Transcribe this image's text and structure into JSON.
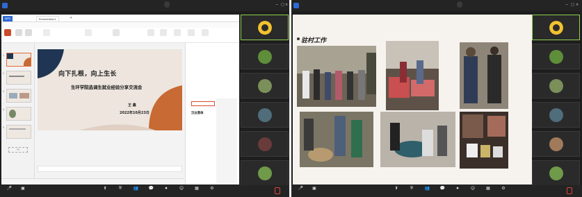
{
  "left": {
    "topbar": {
      "signal": "",
      "share_pill": "",
      "view_label": ""
    },
    "wps": {
      "tabs": [
        "WPS",
        "",
        "",
        "Presentation1"
      ],
      "menus": [
        "",
        "",
        "",
        "",
        "",
        "",
        "",
        "",
        "",
        "",
        "",
        ""
      ],
      "ribbon": [
        "",
        "",
        "",
        "",
        "",
        "",
        "",
        "",
        "",
        "",
        "",
        "",
        "",
        "",
        "",
        "",
        "",
        "",
        ""
      ]
    },
    "thumb_tabs": "",
    "thumb_numbers": [
      "1",
      "2",
      "3",
      "4",
      "5"
    ],
    "slide": {
      "title": "向下扎根，向上生长",
      "subtitle": "生环学院选调生就业经验分享交流会",
      "name": "王 鑫",
      "date": "2022年10月23日"
    },
    "notes_placeholder": "",
    "status_text": "",
    "taskpane": {
      "title": "",
      "tabs": [
        "",
        "",
        ""
      ],
      "sections": [
        "",
        ""
      ],
      "search_placeholder": "",
      "fonts": [
        "汉仪黑体",
        "",
        "",
        "",
        "",
        "",
        "",
        "",
        ""
      ]
    },
    "gallery": [
      {
        "name": ""
      },
      {
        "name": ""
      },
      {
        "name": ""
      },
      {
        "name": ""
      },
      {
        "name": ""
      },
      {
        "name": ""
      }
    ],
    "bottombar": [
      "",
      "",
      "",
      "",
      "",
      "",
      "",
      "",
      "",
      ""
    ],
    "end_button": ""
  },
  "right": {
    "topbar": {
      "signal": "",
      "share_pill": "",
      "view_label": ""
    },
    "slide_title": "驻村工作",
    "gallery": [
      {
        "name": ""
      },
      {
        "name": ""
      },
      {
        "name": ""
      },
      {
        "name": ""
      },
      {
        "name": ""
      },
      {
        "name": ""
      }
    ],
    "bottombar": [
      "",
      "",
      "",
      "",
      "",
      "",
      "",
      "",
      "",
      ""
    ],
    "end_button": ""
  }
}
